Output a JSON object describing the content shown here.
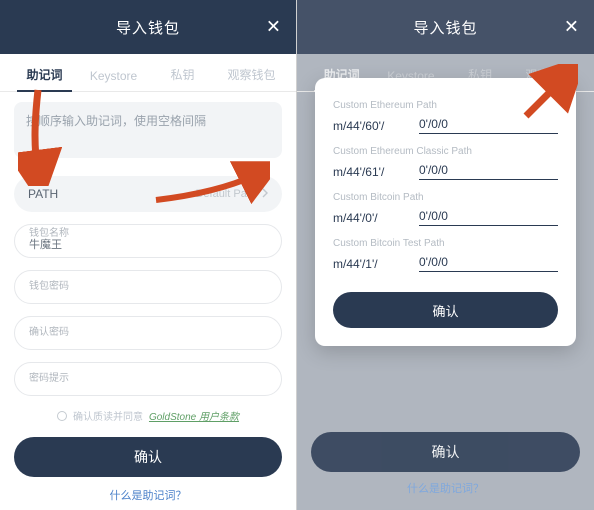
{
  "header": {
    "title": "导入钱包"
  },
  "tabs": [
    {
      "label": "助记词",
      "active": true
    },
    {
      "label": "Keystore",
      "active": false
    },
    {
      "label": "私钥",
      "active": false
    },
    {
      "label": "观察钱包",
      "active": false
    }
  ],
  "mnemonic_placeholder": "按顺序输入助记词，使用空格间隔",
  "path_row": {
    "label": "PATH",
    "value": "Default Path"
  },
  "fields": {
    "wallet_name": {
      "label": "钱包名称",
      "value": "牛魔王"
    },
    "password": {
      "label": "钱包密码"
    },
    "confirm_password": {
      "label": "确认密码"
    },
    "password_hint": {
      "label": "密码提示"
    }
  },
  "terms": {
    "prefix": "确认质读并同意",
    "link": "GoldStone 用户条款"
  },
  "confirm_label": "确认",
  "bottom_link": "什么是助记词？",
  "modal": {
    "sections": [
      {
        "title": "Custom Ethereum Path",
        "col1": "m/44'/60'/",
        "col2": "0'/0/0"
      },
      {
        "title": "Custom Ethereum Classic Path",
        "col1": "m/44'/61'/",
        "col2": "0'/0/0"
      },
      {
        "title": "Custom Bitcoin Path",
        "col1": "m/44'/0'/",
        "col2": "0'/0/0"
      },
      {
        "title": "Custom Bitcoin Test Path",
        "col1": "m/44'/1'/",
        "col2": "0'/0/0"
      }
    ],
    "confirm_label": "确认"
  },
  "colors": {
    "primary": "#2a3a52",
    "arrow": "#d24a22"
  }
}
